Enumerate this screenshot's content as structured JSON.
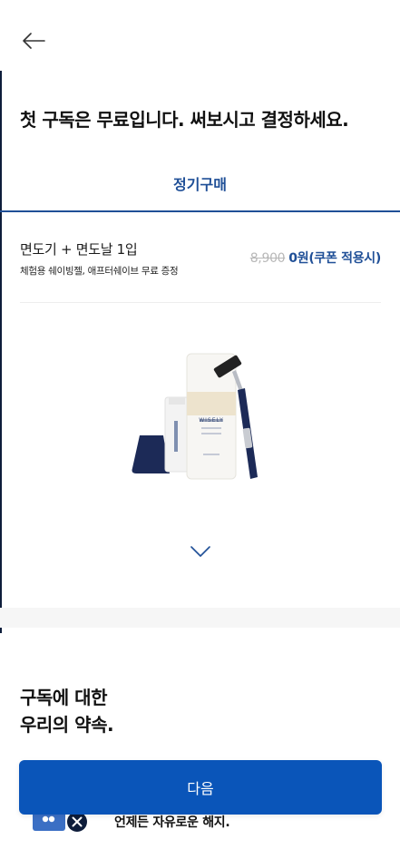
{
  "header": {
    "back_icon": "arrow-left-icon"
  },
  "headline": "첫 구독은 무료입니다. 써보시고 결정하세요.",
  "tabs": [
    {
      "label": "정기구매",
      "selected": true
    }
  ],
  "product": {
    "name": "면도기 + 면도날 1입",
    "description": "체험용 쉐이빙젤, 애프터쉐이브 무료 증정",
    "original_price": "8,900",
    "final_price": "0원(쿠폰 적용시)",
    "brand_on_package": "WISELY",
    "expand_icon": "chevron-down-icon"
  },
  "promise": {
    "title_line1": "구독에 대한",
    "title_line2": "우리의 약속.",
    "items": [
      {
        "icon": "card-cancel-icon",
        "text": "언제든 자유로운 해지."
      }
    ]
  },
  "cta": {
    "next_label": "다음"
  },
  "colors": {
    "accent": "#1f4f97",
    "button": "#0a55b9",
    "muted_price": "#b8b8b8",
    "navy_product": "#1c2a57"
  }
}
